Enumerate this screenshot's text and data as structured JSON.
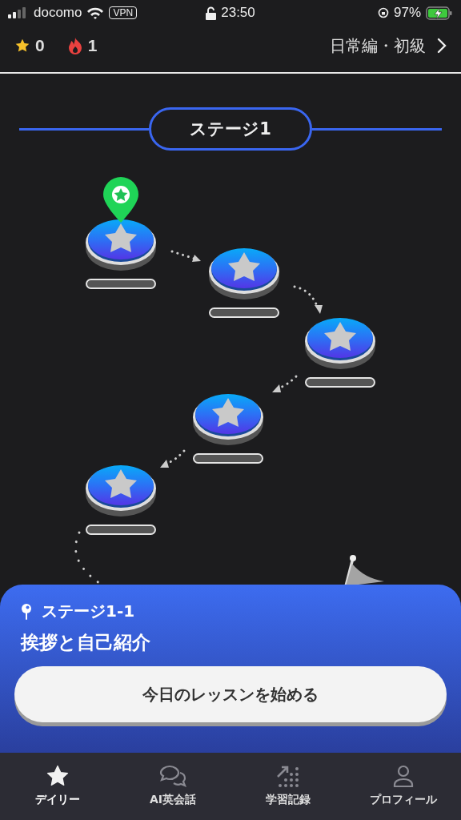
{
  "status_bar": {
    "carrier": "docomo",
    "vpn": "VPN",
    "time": "23:50",
    "battery": "97%"
  },
  "header": {
    "stars": "0",
    "streak": "1",
    "course": "日常編・初級"
  },
  "stage": {
    "title": "ステージ1"
  },
  "nodes": [
    {
      "current": true
    },
    {
      "current": false
    },
    {
      "current": false
    },
    {
      "current": false
    },
    {
      "current": false
    }
  ],
  "sheet": {
    "stage_label": "ステージ1-1",
    "lesson_title": "挨拶と自己紹介",
    "start_button": "今日のレッスンを始める"
  },
  "tabs": [
    {
      "label": "デイリー",
      "selected": true
    },
    {
      "label": "AI英会話",
      "selected": false
    },
    {
      "label": "学習記録",
      "selected": false
    },
    {
      "label": "プロフィール",
      "selected": false
    }
  ]
}
